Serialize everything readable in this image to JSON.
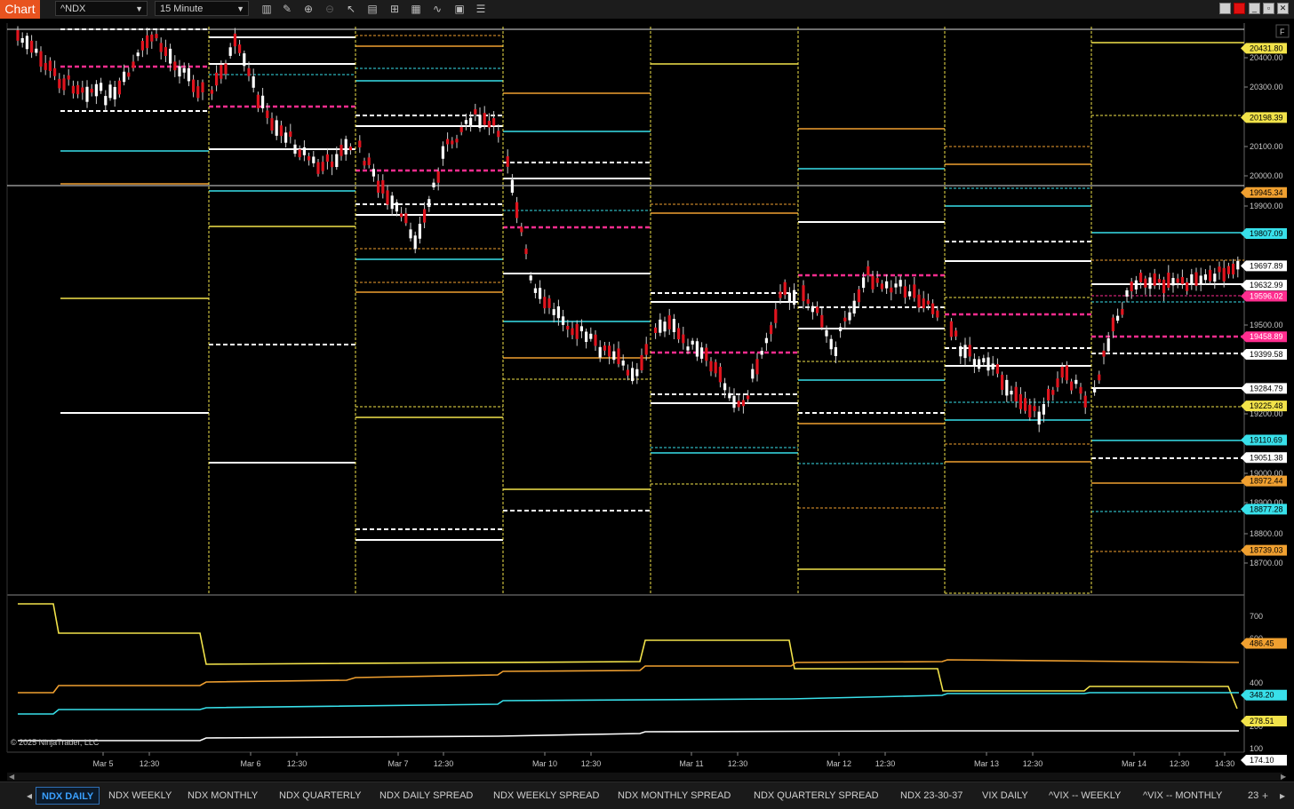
{
  "toolbar": {
    "chart_label": "Chart",
    "instrument": "^NDX",
    "interval": "15 Minute",
    "icons": [
      "bar-type-icon",
      "draw-pencil-icon",
      "zoom-in-icon",
      "zoom-out-icon",
      "pointer-icon",
      "properties-icon",
      "template-icon",
      "data-box-icon",
      "indicators-icon",
      "strategies-icon",
      "more-icon"
    ]
  },
  "window_controls": [
    "restore-icon",
    "link-red-icon",
    "minimize-icon",
    "maximize-icon",
    "close-icon"
  ],
  "price_axis": {
    "labels": [
      "20400.00",
      "20300.00",
      "20100.00",
      "20000.00",
      "19900.00",
      "19500.00",
      "19200.00",
      "19000.00",
      "18900.00",
      "18800.00",
      "18700.00"
    ]
  },
  "price_flags": [
    {
      "value": "20431.80",
      "color": "#f2e34a"
    },
    {
      "value": "20198.39",
      "color": "#f2e34a"
    },
    {
      "value": "19945.34",
      "color": "#f0a030"
    },
    {
      "value": "19807.09",
      "color": "#38e0ea"
    },
    {
      "value": "19697.89",
      "color": "#ffffff"
    },
    {
      "value": "19632.99",
      "color": "#ffffff"
    },
    {
      "value": "19596.02",
      "color": "#ff2d8f"
    },
    {
      "value": "19458.89",
      "color": "#ff2d8f"
    },
    {
      "value": "19399.58",
      "color": "#ffffff"
    },
    {
      "value": "19284.79",
      "color": "#ffffff"
    },
    {
      "value": "19225.48",
      "color": "#f2e34a"
    },
    {
      "value": "19110.69",
      "color": "#38e0ea"
    },
    {
      "value": "19051.38",
      "color": "#ffffff"
    },
    {
      "value": "18972.44",
      "color": "#f0a030"
    },
    {
      "value": "18877.28",
      "color": "#38e0ea"
    },
    {
      "value": "18739.03",
      "color": "#f0a030"
    }
  ],
  "lower_panel": {
    "axis_labels": [
      "700",
      "600",
      "400",
      "200",
      "100"
    ],
    "flags": [
      {
        "value": "486.45",
        "color": "#f0a030"
      },
      {
        "value": "348.20",
        "color": "#38e0ea"
      },
      {
        "value": "278.51",
        "color": "#f2e34a"
      },
      {
        "value": "174.10",
        "color": "#ffffff"
      }
    ]
  },
  "time_axis": [
    "Mar 5",
    "12:30",
    "Mar 6",
    "12:30",
    "Mar 7",
    "12:30",
    "Mar 10",
    "12:30",
    "Mar 11",
    "12:30",
    "Mar 12",
    "12:30",
    "Mar 13",
    "12:30",
    "Mar 14",
    "12:30",
    "14:30"
  ],
  "copyright": "© 2025 NinjaTrader, LLC",
  "panel_marker": "F",
  "tabs": [
    "NDX DAILY",
    "NDX WEEKLY",
    "NDX MONTHLY",
    "NDX QUARTERLY",
    "NDX DAILY SPREAD",
    "NDX WEEKLY SPREAD",
    "NDX MONTHLY SPREAD",
    "NDX QUARTERLY SPREAD",
    "NDX 23-30-37",
    "VIX DAILY",
    "^VIX -- WEEKLY",
    "^VIX -- MONTHLY",
    "23"
  ],
  "active_tab": "NDX DAILY"
}
